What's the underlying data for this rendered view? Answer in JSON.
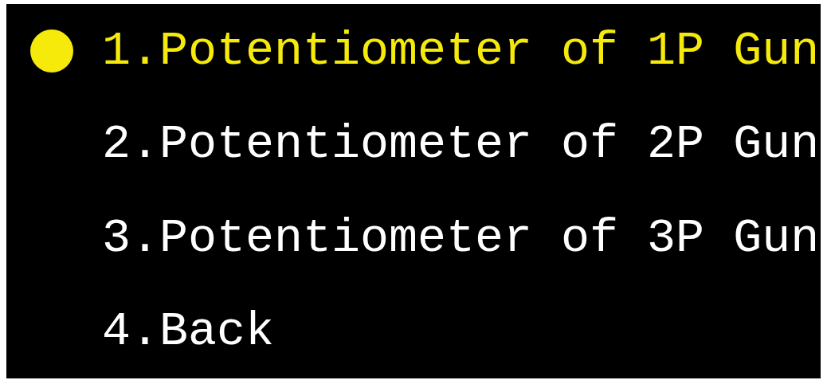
{
  "menu": {
    "items": [
      {
        "label": "1.Potentiometer of 1P Gun",
        "selected": true
      },
      {
        "label": "2.Potentiometer of 2P Gun",
        "selected": false
      },
      {
        "label": "3.Potentiometer of 3P Gun",
        "selected": false
      },
      {
        "label": "4.Back",
        "selected": false
      }
    ]
  }
}
